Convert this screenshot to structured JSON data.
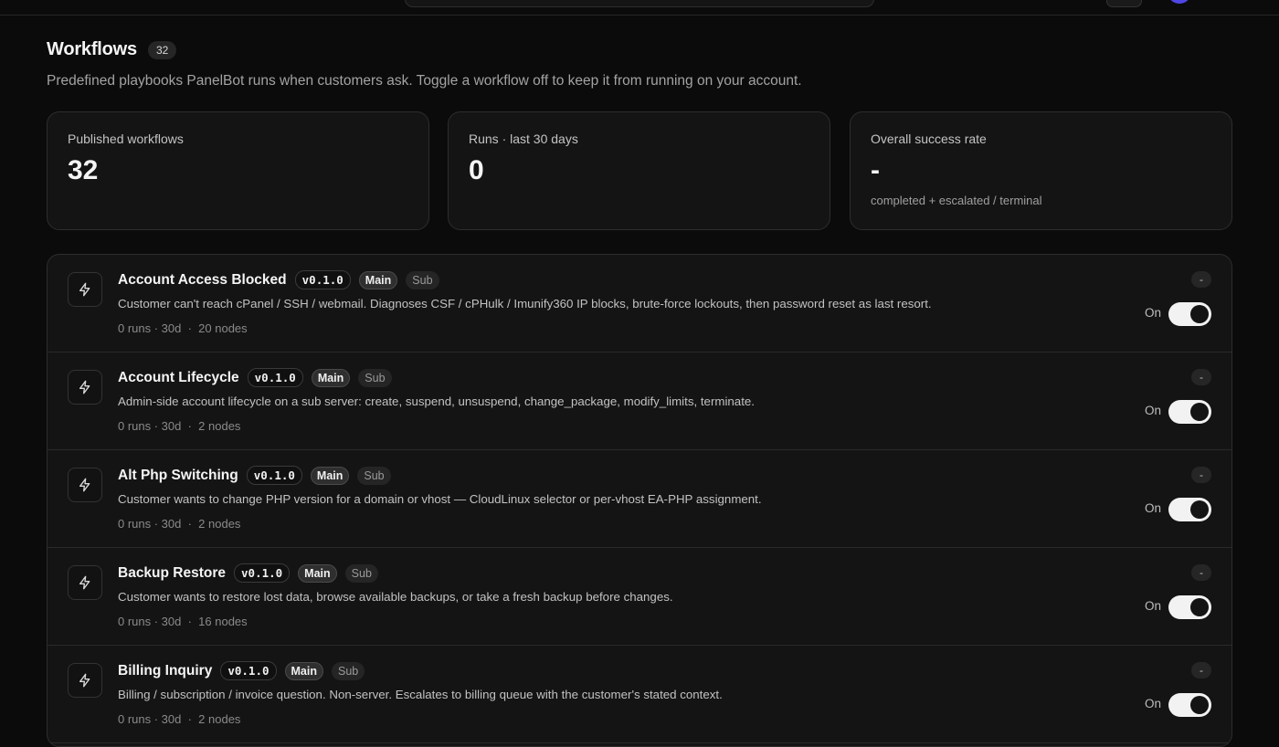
{
  "page": {
    "title": "Workflows",
    "count": "32",
    "subtitle": "Predefined playbooks PanelBot runs when customers ask. Toggle a workflow off to keep it from running on your account."
  },
  "stats": [
    {
      "label": "Published workflows",
      "value": "32",
      "note": ""
    },
    {
      "label": "Runs · last 30 days",
      "value": "0",
      "note": ""
    },
    {
      "label": "Overall success rate",
      "value": "-",
      "note": "completed + escalated / terminal"
    }
  ],
  "workflows": [
    {
      "name": "Account Access Blocked",
      "version": "v0.1.0",
      "tag_main": "Main",
      "tag_sub": "Sub",
      "description": "Customer can't reach cPanel / SSH / webmail. Diagnoses CSF / cPHulk / Imunify360 IP blocks, brute-force lockouts, then password reset as last resort.",
      "runs": "0 runs · 30d",
      "nodes": "20 nodes",
      "rate": "-",
      "toggle_label": "On",
      "enabled": true
    },
    {
      "name": "Account Lifecycle",
      "version": "v0.1.0",
      "tag_main": "Main",
      "tag_sub": "Sub",
      "description": "Admin-side account lifecycle on a sub server: create, suspend, unsuspend, change_package, modify_limits, terminate.",
      "runs": "0 runs · 30d",
      "nodes": "2 nodes",
      "rate": "-",
      "toggle_label": "On",
      "enabled": true
    },
    {
      "name": "Alt Php Switching",
      "version": "v0.1.0",
      "tag_main": "Main",
      "tag_sub": "Sub",
      "description": "Customer wants to change PHP version for a domain or vhost — CloudLinux selector or per-vhost EA-PHP assignment.",
      "runs": "0 runs · 30d",
      "nodes": "2 nodes",
      "rate": "-",
      "toggle_label": "On",
      "enabled": true
    },
    {
      "name": "Backup Restore",
      "version": "v0.1.0",
      "tag_main": "Main",
      "tag_sub": "Sub",
      "description": "Customer wants to restore lost data, browse available backups, or take a fresh backup before changes.",
      "runs": "0 runs · 30d",
      "nodes": "16 nodes",
      "rate": "-",
      "toggle_label": "On",
      "enabled": true
    },
    {
      "name": "Billing Inquiry",
      "version": "v0.1.0",
      "tag_main": "Main",
      "tag_sub": "Sub",
      "description": "Billing / subscription / invoice question. Non-server. Escalates to billing queue with the customer's stated context.",
      "runs": "0 runs · 30d",
      "nodes": "2 nodes",
      "rate": "-",
      "toggle_label": "On",
      "enabled": true
    }
  ]
}
